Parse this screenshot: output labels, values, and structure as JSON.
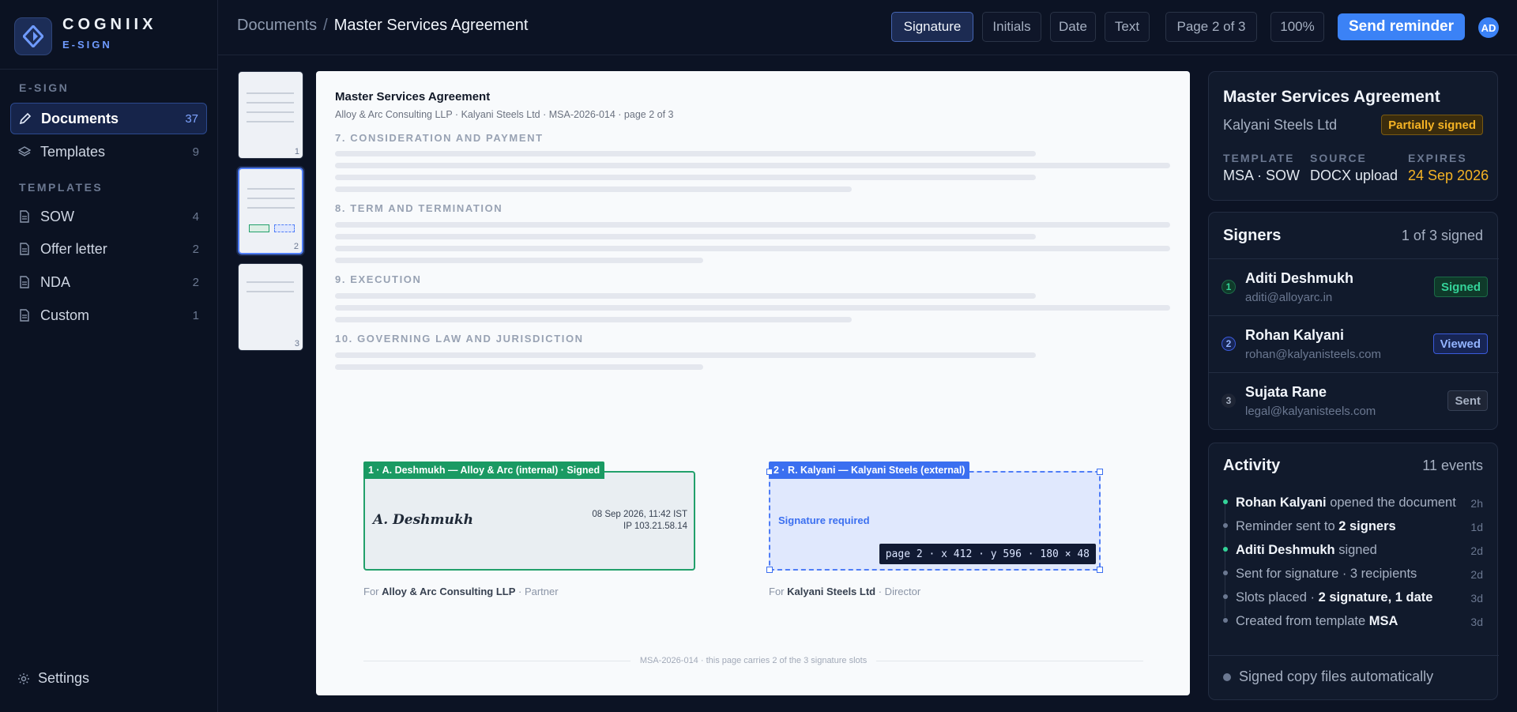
{
  "brand": {
    "name": "COGNIIX",
    "sub": "E-SIGN"
  },
  "sidebar": {
    "section1": "E-SIGN",
    "items": [
      {
        "label": "Documents",
        "count": "37"
      },
      {
        "label": "Templates",
        "count": "9"
      }
    ],
    "section2": "TEMPLATES",
    "templates": [
      {
        "label": "SOW",
        "count": "4"
      },
      {
        "label": "Offer letter",
        "count": "2"
      },
      {
        "label": "NDA",
        "count": "2"
      },
      {
        "label": "Custom",
        "count": "1"
      }
    ],
    "settings": "Settings"
  },
  "topbar": {
    "crumb_root": "Documents",
    "crumb_sep": "/",
    "crumb_current": "Master Services Agreement",
    "tools": [
      "Signature",
      "Initials",
      "Date",
      "Text"
    ],
    "page": "Page 2 of 3",
    "zoom": "100%",
    "send": "Send reminder",
    "avatar": "AD"
  },
  "thumbs": [
    "1",
    "2",
    "3"
  ],
  "doc": {
    "title": "Master Services Agreement",
    "meta": "Alloy & Arc Consulting LLP · Kalyani Steels Ltd · MSA-2026-014 · page 2 of 3",
    "headings": [
      "7. CONSIDERATION AND PAYMENT",
      "8. TERM AND TERMINATION",
      "9. EXECUTION",
      "10. GOVERNING LAW AND JURISDICTION"
    ],
    "slot1": {
      "tag": "1 · A. Deshmukh — Alloy & Arc (internal) · Signed",
      "signature": "A. Deshmukh",
      "stamp_time": "08 Sep 2026, 11:42 IST",
      "stamp_ip": "IP 103.21.58.14",
      "for_prefix": "For",
      "for_org": "Alloy & Arc Consulting LLP",
      "for_role": "· Partner"
    },
    "slot2": {
      "tag": "2 · R. Kalyani — Kalyani Steels (external)",
      "required": "Signature required",
      "coord": "page 2 · x 412 · y 596 · 180 × 48",
      "for_prefix": "For",
      "for_org": "Kalyani Steels Ltd",
      "for_role": "· Director"
    },
    "footer": "MSA-2026-014 · this page carries 2 of the 3 signature slots"
  },
  "summary": {
    "title": "Master Services Agreement",
    "party": "Kalyani Steels Ltd",
    "status": "Partially signed",
    "template_k": "TEMPLATE",
    "template_v": "MSA · SOW",
    "source_k": "SOURCE",
    "source_v": "DOCX upload",
    "expires_k": "EXPIRES",
    "expires_v": "24 Sep 2026",
    "expires_color": "#f5b324"
  },
  "signers": {
    "title": "Signers",
    "count": "1 of 3 signed",
    "list": [
      {
        "num": "1",
        "name": "Aditi Deshmukh",
        "email": "aditi@alloyarc.in",
        "status": "Signed"
      },
      {
        "num": "2",
        "name": "Rohan Kalyani",
        "email": "rohan@kalyanisteels.com",
        "status": "Viewed"
      },
      {
        "num": "3",
        "name": "Sujata Rane",
        "email": "legal@kalyanisteels.com",
        "status": "Sent"
      }
    ]
  },
  "activity": {
    "title": "Activity",
    "count": "11 events",
    "events": [
      {
        "who": "Rohan Kalyani",
        "text": " opened the document",
        "time": "2h",
        "color": "#34d399"
      },
      {
        "pre": "Reminder sent to ",
        "bold": "2 signers",
        "time": "1d",
        "color": "#6b7891"
      },
      {
        "who": "Aditi Deshmukh",
        "text": " signed",
        "time": "2d",
        "color": "#34d399"
      },
      {
        "pre": "Sent for signature · 3 recipients",
        "time": "2d",
        "color": "#6b7891"
      },
      {
        "pre": "Slots placed · ",
        "bold": "2 signature, 1 date",
        "time": "3d",
        "color": "#6b7891"
      },
      {
        "pre": "Created from template ",
        "bold": "MSA",
        "time": "3d",
        "color": "#6b7891"
      }
    ],
    "auto": "Signed copy files automatically"
  }
}
